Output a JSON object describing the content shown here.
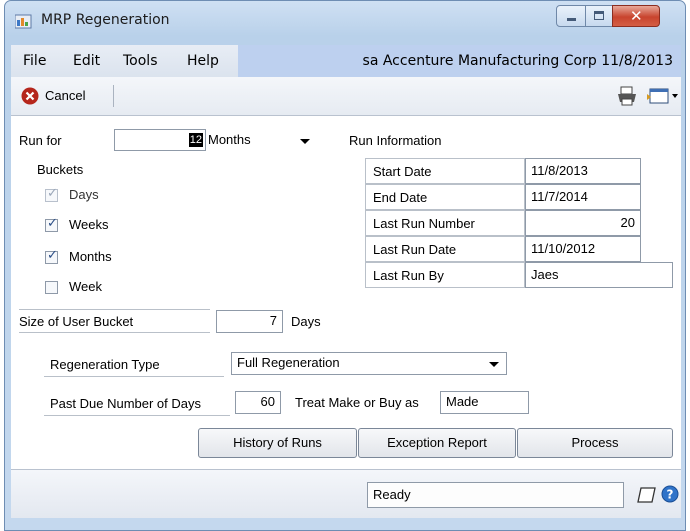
{
  "window": {
    "title": "MRP Regeneration"
  },
  "menu": {
    "items": [
      "File",
      "Edit",
      "Tools",
      "Help"
    ],
    "company": "sa  Accenture Manufacturing Corp  11/8/2013"
  },
  "toolbar": {
    "cancel_label": "Cancel"
  },
  "form": {
    "run_for": {
      "label": "Run for",
      "value": "12",
      "unit": "Months"
    },
    "buckets": {
      "label": "Buckets",
      "items": [
        {
          "label": "Days",
          "checked": true,
          "disabled": true
        },
        {
          "label": "Weeks",
          "checked": true,
          "disabled": false
        },
        {
          "label": "Months",
          "checked": true,
          "disabled": false
        },
        {
          "label": "Week",
          "checked": false,
          "disabled": false
        }
      ]
    },
    "user_bucket": {
      "label": "Size of User Bucket",
      "value": "7",
      "unit": "Days"
    },
    "run_information": {
      "label": "Run Information",
      "rows": [
        {
          "label": "Start Date",
          "value": "11/8/2013"
        },
        {
          "label": "End Date",
          "value": "11/7/2014"
        },
        {
          "label": "Last Run Number",
          "value": "20"
        },
        {
          "label": "Last Run Date",
          "value": "11/10/2012"
        },
        {
          "label": "Last Run By",
          "value": "Jaes"
        }
      ]
    },
    "regeneration_type": {
      "label": "Regeneration Type",
      "value": "Full Regeneration"
    },
    "past_due": {
      "label": "Past Due Number of Days",
      "value": "60"
    },
    "make_or_buy": {
      "label": "Treat Make or Buy as",
      "value": "Made"
    },
    "buttons": {
      "history": "History of Runs",
      "exception": "Exception Report",
      "process": "Process"
    }
  },
  "status": {
    "text": "Ready"
  }
}
